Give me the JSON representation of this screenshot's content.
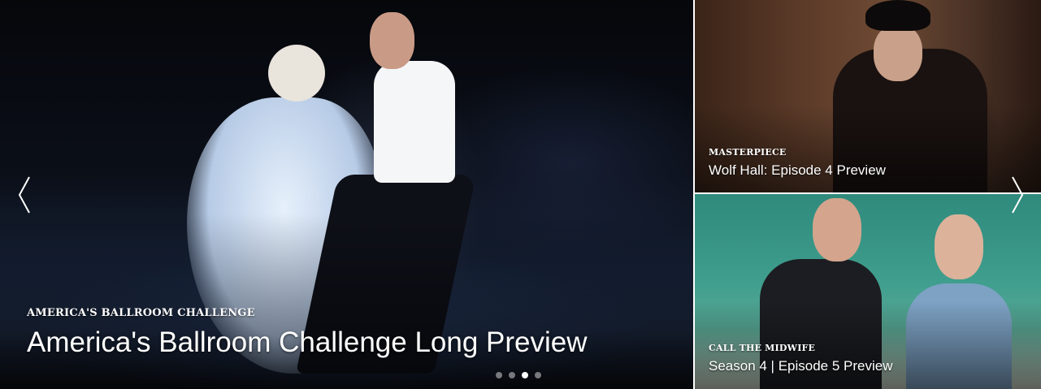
{
  "slides": {
    "main": {
      "show": "AMERICA'S BALLROOM CHALLENGE",
      "title": "America's Ballroom Challenge Long Preview"
    },
    "side_top": {
      "show": "MASTERPIECE",
      "title": "Wolf Hall: Episode 4 Preview"
    },
    "side_bottom": {
      "show": "CALL THE MIDWIFE",
      "title": "Season 4 | Episode 5 Preview"
    }
  },
  "pagination": {
    "count": 4,
    "active_index": 2
  },
  "icons": {
    "prev": "chevron-left-icon",
    "next": "chevron-right-icon"
  },
  "colors": {
    "caption_text": "#ffffff",
    "dot_inactive": "rgba(255,255,255,0.45)",
    "dot_active": "#ffffff"
  }
}
